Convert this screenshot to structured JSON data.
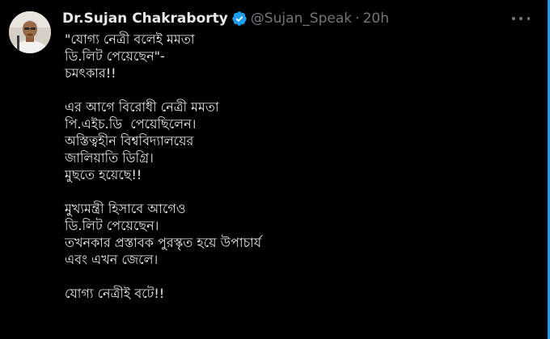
{
  "tweet": {
    "author_name": "Dr.Sujan Chakraborty",
    "handle": "@Sujan_Speak",
    "separator": "·",
    "time": "20h",
    "verified_badge_color": "#1d9bf0",
    "avatar": "profile-photo",
    "more_icon": "more-options-icon",
    "lines": [
      "\"যোগ্য নেত্রী বলেই মমতা",
      "ডি.লিট পেয়েছেন\"-",
      "চমৎকার!!",
      "",
      "এর আগে বিরোধী নেত্রী মমতা",
      "পি.এইচ.ডি  পেয়েছিলেন।",
      "অস্তিত্বহীন বিশ্ববিদ্যালয়ের",
      "জালিয়াতি ডিগ্রি।",
      "মুছতে হয়েছে!!",
      "",
      "মুখ্যমন্ত্রী হিসাবে আগেও",
      "ডি.লিট পেয়েছেন।",
      "তখনকার প্রস্তাবক পুরস্কৃত হয়ে উপাচার্য",
      "এবং এখন জেলে।",
      "",
      "যোগ্য নেত্রীই বটে!!"
    ]
  },
  "colors": {
    "background": "#000000",
    "primary_text": "#e7e9ea",
    "secondary_text": "#71767b",
    "accent": "#1d9bf0"
  }
}
